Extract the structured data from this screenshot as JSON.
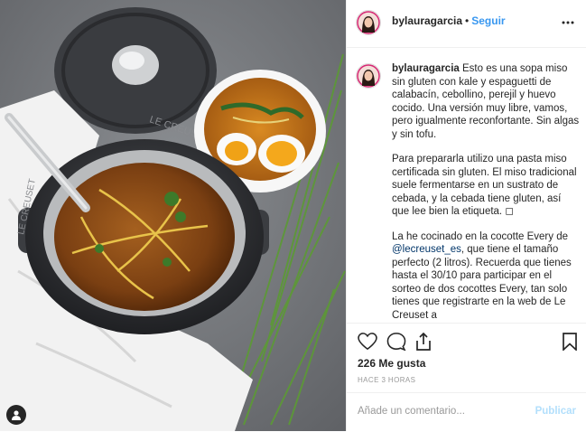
{
  "post": {
    "username": "bylauragarcia",
    "separator": "•",
    "follow_label": "Seguir",
    "more_icon": "more-options-icon",
    "caption": {
      "username": "bylauragarcia",
      "paragraph1": "Esto es una sopa miso sin gluten con kale y espaguetti de calabacín, cebollino, perejil y huevo cocido. Una versión muy libre, vamos, pero igualmente reconfortante. Sin algas y sin tofu.",
      "paragraph2": "Para prepararla utilizo una pasta miso certificada sin gluten. El miso tradicional suele fermentarse en un sustrato de cebada, y la cebada tiene gluten, así que lee bien la etiqueta. ◻",
      "paragraph3_before": "La he cocinado en la cocotte Every de ",
      "paragraph3_mention": "@lecreuset_es",
      "paragraph3_after": ", que tiene el tamaño perfecto (2 litros). Recuerda que tienes hasta el 30/10 para participar en el sorteo de dos cocottes Every, tan solo tienes que registrarte en la web de Le Creuset a"
    },
    "likes_text": "226 Me gusta",
    "time_text": "HACE 3 HORAS",
    "comment_placeholder": "Añade un comentario...",
    "publish_label": "Publicar",
    "lid_text": "LE CREUSET",
    "pot_text": "LE CREUSET"
  },
  "colors": {
    "link_blue": "#3897f0",
    "mention_blue": "#003569",
    "publish_disabled": "#b2dffc",
    "divider": "#efefef"
  }
}
